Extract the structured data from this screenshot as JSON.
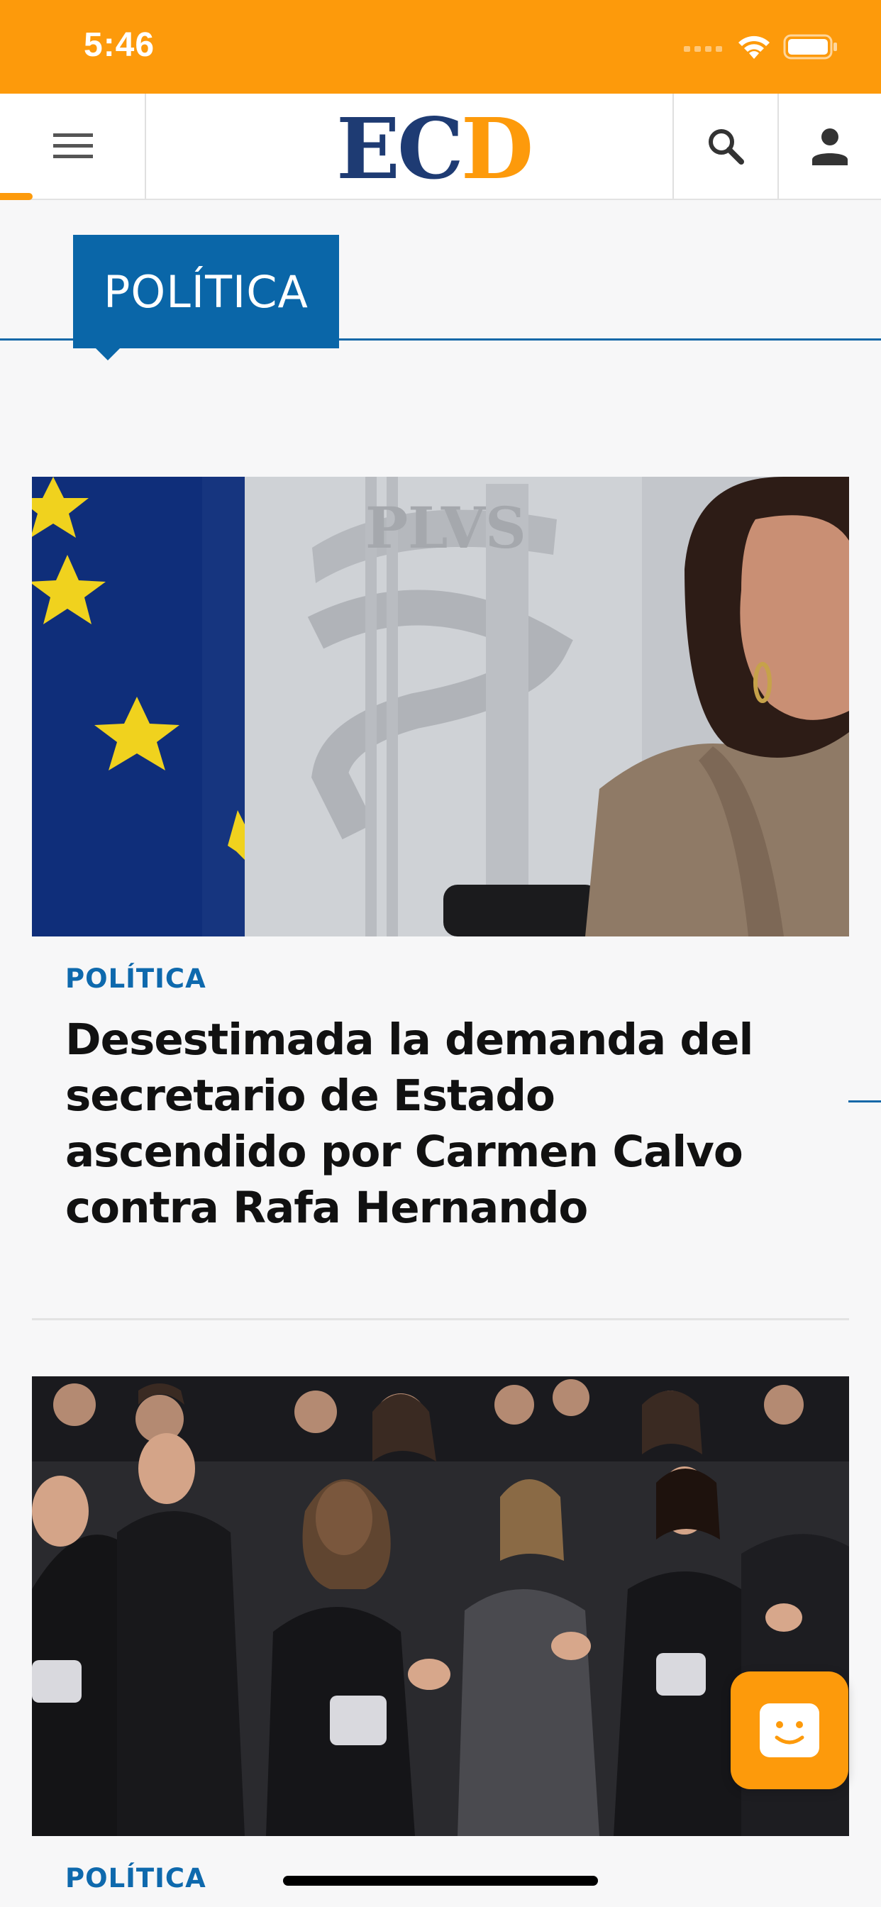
{
  "status_bar": {
    "time": "5:46",
    "background": "#fd9a0b"
  },
  "header": {
    "logo": {
      "part1": "EC",
      "part2": "D",
      "color1": "#1e3b73",
      "color2": "#fd9a0b"
    },
    "icons": [
      "menu-icon",
      "search-icon",
      "user-icon"
    ]
  },
  "section": {
    "label": "POLÍTICA",
    "color": "#0a66a8"
  },
  "articles": [
    {
      "category": "POLÍTICA",
      "title": "Desestimada la demanda del secretario de Estado ascendido por Carmen Calvo contra Rafa Hernando",
      "image_description": "photo-eu-flag-woman"
    },
    {
      "category": "POLÍTICA",
      "title": "",
      "image_description": "photo-group-in-robes-applauding"
    }
  ],
  "chat": {
    "icon": "smiley-chat-icon",
    "color": "#fd9a0b"
  }
}
